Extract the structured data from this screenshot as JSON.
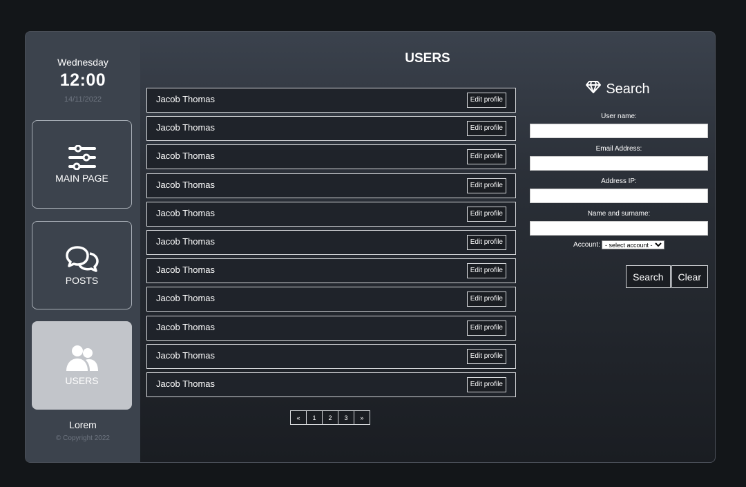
{
  "sidebar": {
    "day": "Wednesday",
    "time": "12:00",
    "date": "14/11/2022",
    "items": [
      {
        "label": "MAIN PAGE",
        "icon": "sliders-icon"
      },
      {
        "label": "POSTS",
        "icon": "chat-bubbles-icon"
      },
      {
        "label": "USERS",
        "icon": "users-icon",
        "active": true
      }
    ],
    "footer_title": "Lorem",
    "copyright": "© Copyright 2022"
  },
  "main": {
    "title": "USERS",
    "users": [
      {
        "name": "Jacob Thomas",
        "action": "Edit profile"
      },
      {
        "name": "Jacob Thomas",
        "action": "Edit profile"
      },
      {
        "name": "Jacob Thomas",
        "action": "Edit profile"
      },
      {
        "name": "Jacob Thomas",
        "action": "Edit profile"
      },
      {
        "name": "Jacob Thomas",
        "action": "Edit profile"
      },
      {
        "name": "Jacob Thomas",
        "action": "Edit profile"
      },
      {
        "name": "Jacob Thomas",
        "action": "Edit profile"
      },
      {
        "name": "Jacob Thomas",
        "action": "Edit profile"
      },
      {
        "name": "Jacob Thomas",
        "action": "Edit profile"
      },
      {
        "name": "Jacob Thomas",
        "action": "Edit profile"
      },
      {
        "name": "Jacob Thomas",
        "action": "Edit profile"
      }
    ],
    "pagination": [
      "«",
      "1",
      "2",
      "3",
      "»"
    ]
  },
  "search": {
    "title": "Search",
    "icon": "diamond-icon",
    "fields": {
      "user_name": {
        "label": "User name:",
        "value": ""
      },
      "email": {
        "label": "Email Address:",
        "value": ""
      },
      "ip": {
        "label": "Address IP:",
        "value": ""
      },
      "full_name": {
        "label": "Name and surname:",
        "value": ""
      }
    },
    "account": {
      "label": "Account:",
      "selected": "- select account -"
    },
    "search_label": "Search",
    "clear_label": "Clear"
  }
}
